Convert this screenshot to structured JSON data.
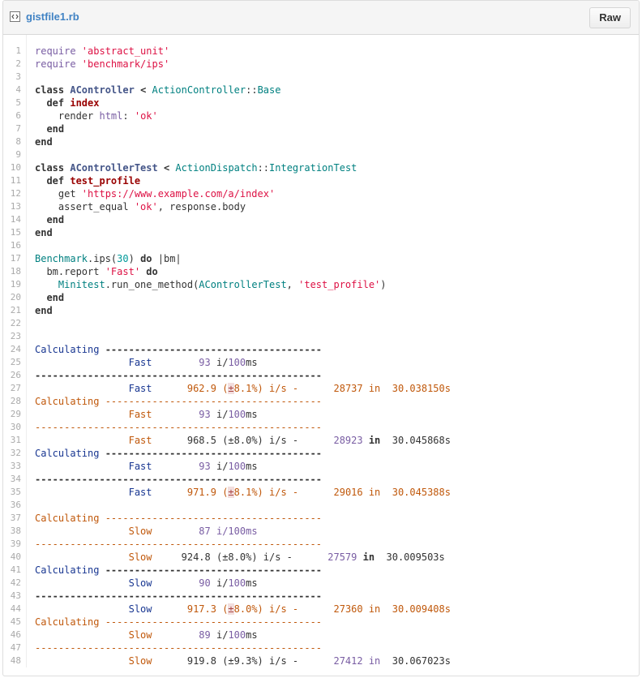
{
  "header": {
    "file_name": "gistfile1.rb",
    "raw_label": "Raw",
    "file_icon": "code-file-icon"
  },
  "lines": [
    [
      "require ",
      "'abstract_unit'"
    ],
    [
      "require ",
      "'benchmark/ips'"
    ],
    [
      ""
    ],
    [
      "class ",
      "AController",
      " < ",
      "ActionController",
      "::",
      "Base"
    ],
    [
      "  def ",
      "index"
    ],
    [
      "    render ",
      "html",
      ": ",
      "'ok'"
    ],
    [
      "  end"
    ],
    [
      "end"
    ],
    [
      ""
    ],
    [
      "class ",
      "AControllerTest",
      " < ",
      "ActionDispatch",
      "::",
      "IntegrationTest"
    ],
    [
      "  def ",
      "test_profile"
    ],
    [
      "    get ",
      "'https://www.example.com/a/index'"
    ],
    [
      "    assert_equal ",
      "'ok'",
      ", response.body"
    ],
    [
      "  end"
    ],
    [
      "end"
    ],
    [
      ""
    ],
    [
      "Benchmark",
      ".ips(",
      "30",
      ") ",
      "do",
      " |bm|"
    ],
    [
      "  bm.report ",
      "'Fast'",
      " do"
    ],
    [
      "    Minitest",
      ".run_one_method(",
      "AControllerTest",
      ", ",
      "'test_profile'",
      ")"
    ],
    [
      "  end"
    ],
    [
      "end"
    ],
    [
      ""
    ],
    [
      ""
    ],
    [
      "Calculating ",
      "-------------------------------------"
    ],
    [
      "                Fast",
      "        93 ",
      "i/",
      "100",
      "ms"
    ],
    [
      "-------------------------------------------------"
    ],
    [
      "                Fast",
      "      962.9 (",
      "±",
      "8.1%) i/s -",
      "      28737 in  ",
      "30.038150s"
    ],
    [
      "Calculating ",
      "-------------------------------------"
    ],
    [
      "                Fast",
      "        93 ",
      "i/",
      "100",
      "ms"
    ],
    [
      "-------------------------------------------------"
    ],
    [
      "                Fast",
      "      968.5 (±8.0%) i/s -",
      "      28923 ",
      "in",
      "  30.045868s"
    ],
    [
      "Calculating ",
      "-------------------------------------"
    ],
    [
      "                Fast",
      "        93 ",
      "i/",
      "100",
      "ms"
    ],
    [
      "-------------------------------------------------"
    ],
    [
      "                Fast",
      "      971.9 (",
      "±",
      "8.1%) i/s -",
      "      29016 in  ",
      "30.045388s"
    ],
    [
      ""
    ],
    [
      "Calculating ",
      "-------------------------------------"
    ],
    [
      "                Slow",
      "        87 i/100ms"
    ],
    [
      "-------------------------------------------------"
    ],
    [
      "                Slow",
      "     924.8 (±8.0%) i/s -",
      "      27579 ",
      "in",
      "  30.009503s"
    ],
    [
      "Calculating ",
      "-------------------------------------"
    ],
    [
      "                Slow",
      "        90 ",
      "i/",
      "100",
      "ms"
    ],
    [
      "-------------------------------------------------"
    ],
    [
      "                Slow",
      "      917.3 (",
      "±",
      "8.0%) i/s -",
      "      27360 in  ",
      "30.009408s"
    ],
    [
      "Calculating ",
      "-------------------------------------"
    ],
    [
      "                Slow",
      "        89 ",
      "i/",
      "100",
      "ms"
    ],
    [
      "-------------------------------------------------"
    ],
    [
      "                Slow",
      "      919.8 (±9.3%) i/s -",
      "      27412 in  ",
      "30.067023s"
    ]
  ],
  "styles": [
    [
      "purple",
      "str"
    ],
    [
      "purple",
      "str"
    ],
    [
      ""
    ],
    [
      "kw",
      "cls",
      "kw",
      "const",
      "",
      "const"
    ],
    [
      "kw",
      "fn"
    ],
    [
      "",
      "purple",
      "",
      "str"
    ],
    [
      "kw"
    ],
    [
      "kw"
    ],
    [
      ""
    ],
    [
      "kw",
      "cls",
      "kw",
      "const",
      "",
      "const"
    ],
    [
      "kw",
      "fn"
    ],
    [
      "",
      "str"
    ],
    [
      "",
      "str",
      ""
    ],
    [
      "kw"
    ],
    [
      "kw"
    ],
    [
      ""
    ],
    [
      "const",
      "",
      "num",
      "",
      "kw",
      ""
    ],
    [
      "",
      "str",
      "kw"
    ],
    [
      "const",
      "",
      "const",
      "",
      "str",
      ""
    ],
    [
      "kw"
    ],
    [
      "kw"
    ],
    [
      ""
    ],
    [
      ""
    ],
    [
      "blue",
      "kw"
    ],
    [
      "blue",
      "purple",
      "",
      "purple",
      ""
    ],
    [
      "kw"
    ],
    [
      "blue",
      "orange",
      "err",
      "orange",
      "orange",
      "orange"
    ],
    [
      "orange",
      "orange"
    ],
    [
      "orange",
      "purple",
      "",
      "purple",
      ""
    ],
    [
      "orange"
    ],
    [
      "orange",
      "",
      "purple",
      "bold",
      ""
    ],
    [
      "blue",
      "kw"
    ],
    [
      "blue",
      "purple",
      "",
      "purple",
      ""
    ],
    [
      "kw"
    ],
    [
      "blue",
      "orange",
      "err",
      "orange",
      "orange",
      "orange"
    ],
    [
      ""
    ],
    [
      "orange",
      "orange"
    ],
    [
      "orange",
      "purple"
    ],
    [
      "orange"
    ],
    [
      "orange",
      "",
      "purple",
      "bold",
      ""
    ],
    [
      "blue",
      "kw"
    ],
    [
      "blue",
      "purple",
      "",
      "purple",
      ""
    ],
    [
      "kw"
    ],
    [
      "blue",
      "orange",
      "err",
      "orange",
      "orange",
      "orange"
    ],
    [
      "orange",
      "orange"
    ],
    [
      "orange",
      "purple",
      "",
      "purple",
      ""
    ],
    [
      "orange"
    ],
    [
      "orange",
      "",
      "purple",
      ""
    ]
  ]
}
